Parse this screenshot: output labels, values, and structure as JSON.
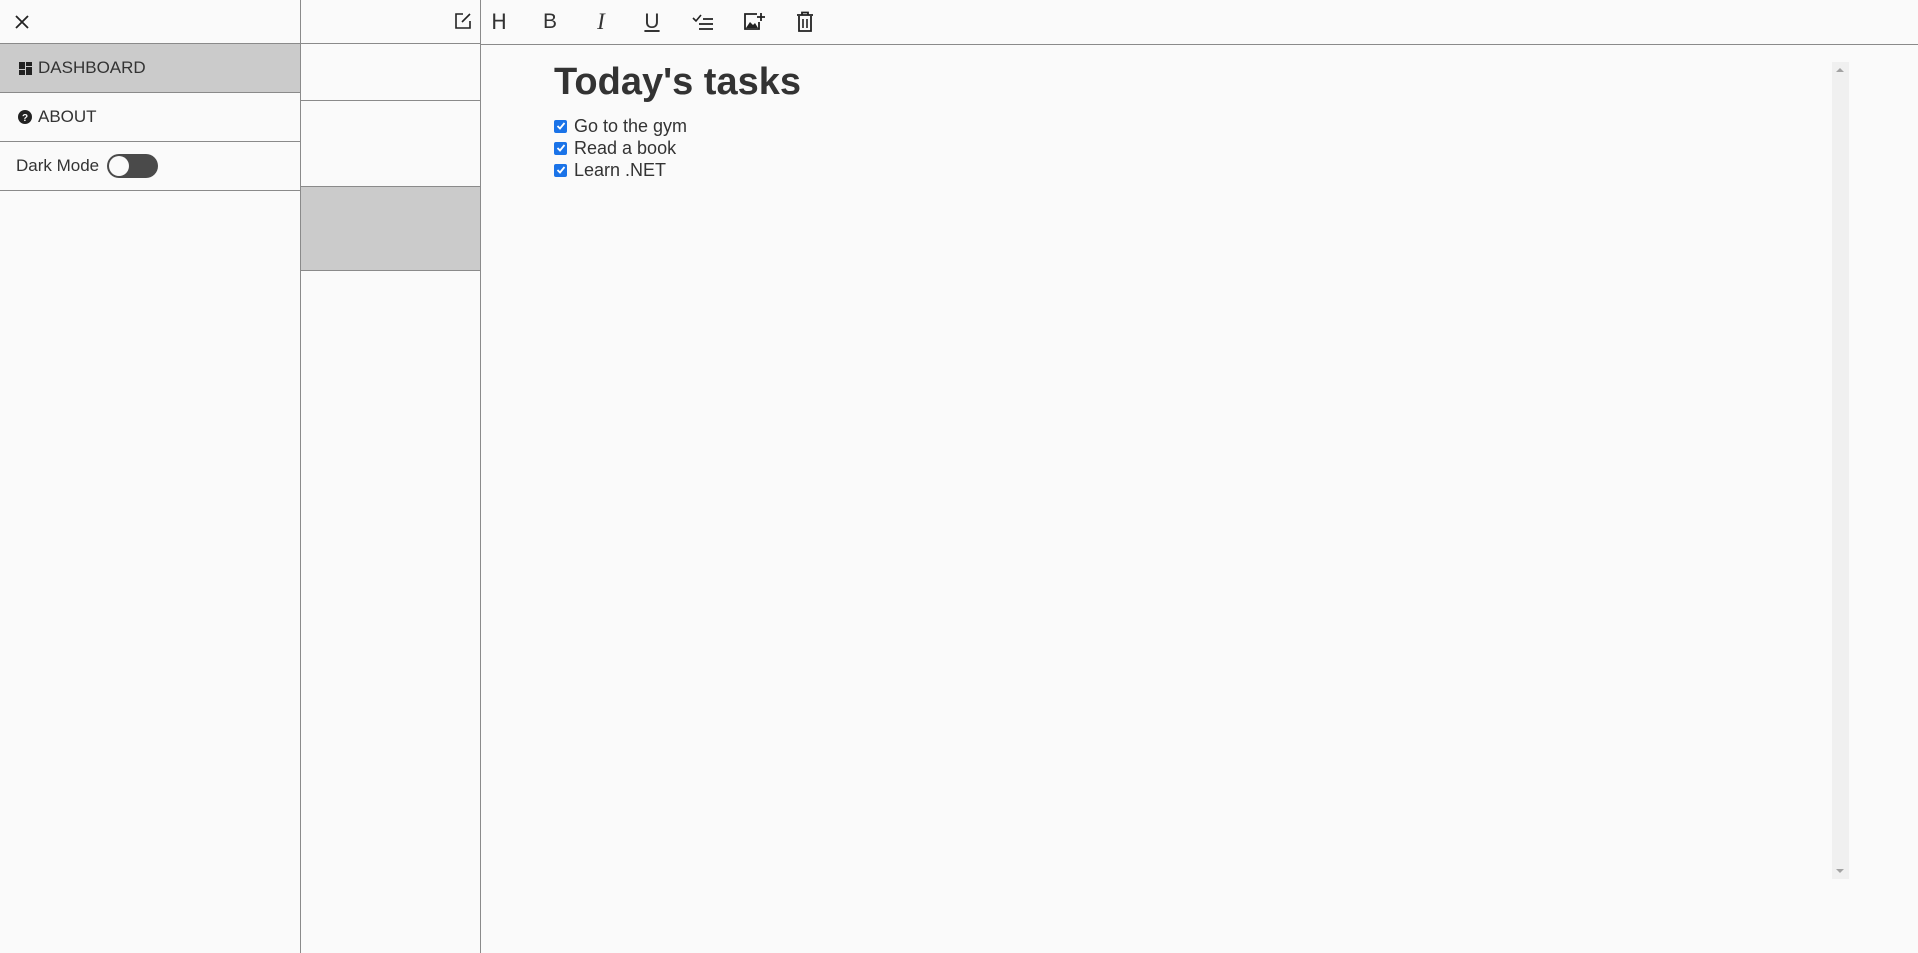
{
  "menu": {
    "close_icon": "close-icon",
    "items": [
      {
        "label": "DASHBOARD",
        "icon": "dashboard-icon",
        "active": true
      },
      {
        "label": "ABOUT",
        "icon": "help-circle-icon",
        "active": false
      }
    ],
    "dark_mode": {
      "label": "Dark Mode",
      "enabled": false
    }
  },
  "notes_list": {
    "new_note_icon": "new-note-icon",
    "selected_index": 2
  },
  "toolbar": {
    "heading": "H",
    "bold": "B",
    "italic": "I",
    "underline": "U",
    "checklist_icon": "checklist-icon",
    "insert_image_icon": "insert-image-icon",
    "delete_icon": "trash-icon"
  },
  "document": {
    "title": "Today's tasks",
    "tasks": [
      {
        "text": "Go to the gym",
        "checked": true
      },
      {
        "text": "Read a book",
        "checked": true
      },
      {
        "text": "Learn .NET",
        "checked": true
      }
    ]
  },
  "colors": {
    "background": "#fafafa",
    "selected_row": "#cbcbcb",
    "border": "#8a8a8a",
    "text": "#333333",
    "checkbox": "#1a73e8",
    "toggle_track": "#4a4a4a"
  }
}
